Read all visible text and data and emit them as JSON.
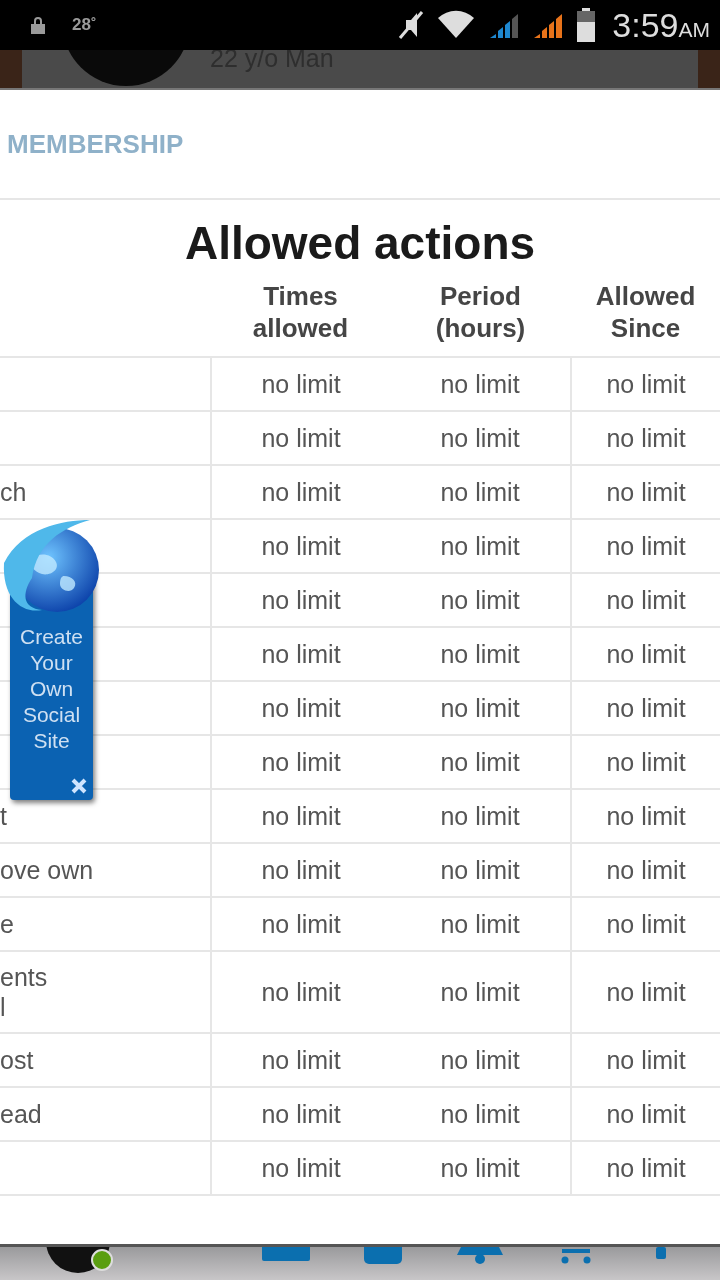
{
  "status_bar": {
    "temperature": "28˚",
    "time": "3:59",
    "meridiem": "AM"
  },
  "background_profile": {
    "subtitle": "22 y/o Man"
  },
  "modal": {
    "tab": "MEMBERSHIP",
    "title": "Allowed actions",
    "columns": [
      "Times allowed",
      "Period (hours)",
      "Allowed Since"
    ],
    "rows": [
      {
        "action": "",
        "times": "no limit",
        "period": "no limit",
        "since": "no limit"
      },
      {
        "action": "",
        "times": "no limit",
        "period": "no limit",
        "since": "no limit"
      },
      {
        "action": "ch",
        "times": "no limit",
        "period": "no limit",
        "since": "no limit"
      },
      {
        "action": "",
        "times": "no limit",
        "period": "no limit",
        "since": "no limit"
      },
      {
        "action": "",
        "times": "no limit",
        "period": "no limit",
        "since": "no limit"
      },
      {
        "action": "",
        "times": "no limit",
        "period": "no limit",
        "since": "no limit"
      },
      {
        "action": "",
        "times": "no limit",
        "period": "no limit",
        "since": "no limit"
      },
      {
        "action": "",
        "times": "no limit",
        "period": "no limit",
        "since": "no limit"
      },
      {
        "action": "t",
        "times": "no limit",
        "period": "no limit",
        "since": "no limit"
      },
      {
        "action": "ove own",
        "times": "no limit",
        "period": "no limit",
        "since": "no limit"
      },
      {
        "action": "e",
        "times": "no limit",
        "period": "no limit",
        "since": "no limit"
      },
      {
        "action": "ents\nl",
        "times": "no limit",
        "period": "no limit",
        "since": "no limit"
      },
      {
        "action": "ost",
        "times": "no limit",
        "period": "no limit",
        "since": "no limit"
      },
      {
        "action": "ead",
        "times": "no limit",
        "period": "no limit",
        "since": "no limit"
      },
      {
        "action": "",
        "times": "no limit",
        "period": "no limit",
        "since": "no limit"
      }
    ]
  },
  "promo": {
    "text": "Create Your Own Social Site"
  }
}
